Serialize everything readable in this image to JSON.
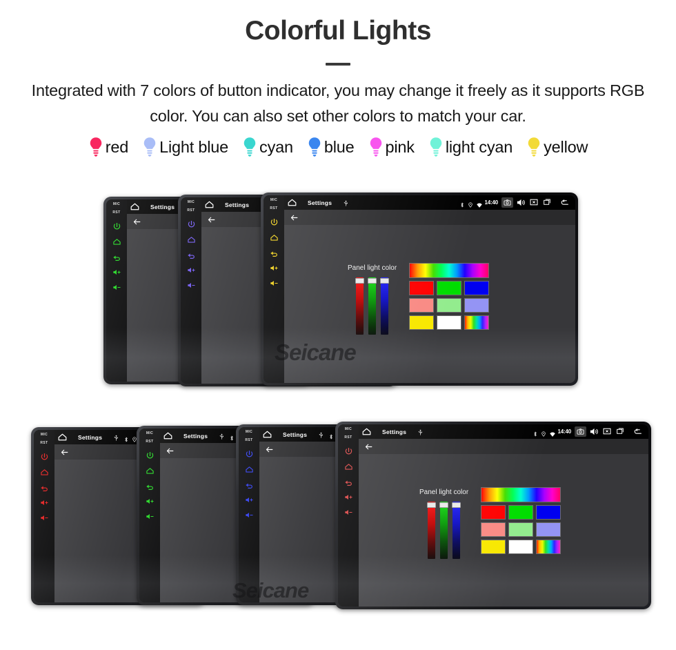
{
  "hero": {
    "title": "Colorful Lights",
    "description": "Integrated with 7 colors of button indicator, you may change it freely as it supports RGB color. You can also set other colors to match your car."
  },
  "legend": {
    "items": [
      {
        "label": "red",
        "color": "#f8275f"
      },
      {
        "label": "Light blue",
        "color": "#a9bdf7"
      },
      {
        "label": "cyan",
        "color": "#3ad6cf"
      },
      {
        "label": "blue",
        "color": "#3a86ef"
      },
      {
        "label": "pink",
        "color": "#f855ee"
      },
      {
        "label": "light cyan",
        "color": "#70f2d8"
      },
      {
        "label": "yellow",
        "color": "#f2da38"
      }
    ]
  },
  "device_ui": {
    "rail": {
      "mic_label": "MIC",
      "rst_label": "RST",
      "icons": [
        "power-icon",
        "home-icon",
        "back-icon",
        "volume-up-icon",
        "volume-down-icon"
      ]
    },
    "statusbar": {
      "home_icon": "home-icon",
      "title": "Settings",
      "usb_icon": "usb-icon",
      "bluetooth_icon": "bluetooth-icon",
      "location_icon": "location-pin-icon",
      "wifi_icon": "wifi-icon",
      "clock": "14:40",
      "camera_icon": "camera-icon",
      "volume_icon": "volume-icon",
      "close_icon": "close-box-icon",
      "recents_icon": "recent-apps-icon",
      "back_icon": "back-arrow-icon"
    },
    "actionbar": {
      "back_icon": "arrow-left-icon"
    },
    "picker": {
      "label": "Panel light color",
      "sliders": [
        {
          "name": "red-slider",
          "value": 100
        },
        {
          "name": "green-slider",
          "value": 100
        },
        {
          "name": "blue-slider",
          "value": 100
        }
      ],
      "swatch_rows": [
        [
          {
            "name": "rainbow-gradient-swatch",
            "color": "rainbow"
          }
        ],
        [
          {
            "name": "red-swatch",
            "color": "#ff0000"
          },
          {
            "name": "green-swatch",
            "color": "#00dd00"
          },
          {
            "name": "blue-swatch",
            "color": "#0000f0"
          }
        ],
        [
          {
            "name": "salmon-swatch",
            "color": "#f98a84"
          },
          {
            "name": "light-green-swatch",
            "color": "#93ec8e"
          },
          {
            "name": "periwinkle-swatch",
            "color": "#9494f4"
          }
        ],
        [
          {
            "name": "yellow-swatch",
            "color": "#f8e800"
          },
          {
            "name": "white-swatch",
            "color": "#ffffff"
          },
          {
            "name": "rainbow-small-swatch",
            "color": "rainbow"
          }
        ]
      ]
    }
  },
  "groups": {
    "top": {
      "devices": [
        {
          "name": "device-green",
          "button_color": "#19d619",
          "title": "Settings",
          "picker": false
        },
        {
          "name": "device-purple",
          "button_color": "#6b52f0",
          "title": "Settings",
          "picker": false
        },
        {
          "name": "device-yellow",
          "button_color": "#f2d113",
          "title": "Settings",
          "picker": true
        }
      ],
      "watermark": "Seicane"
    },
    "bottom": {
      "devices": [
        {
          "name": "device-red-1",
          "button_color": "#e61414",
          "title": "Settings",
          "picker": "partial"
        },
        {
          "name": "device-green-2",
          "button_color": "#19d619",
          "title": "Settings",
          "picker": "partial"
        },
        {
          "name": "device-blue-3",
          "button_color": "#2836f0",
          "title": "Settings",
          "picker": "partial"
        },
        {
          "name": "device-red-4",
          "button_color": "#d94040",
          "title": "Settings",
          "picker": true
        }
      ],
      "watermark": "Seicane"
    }
  }
}
